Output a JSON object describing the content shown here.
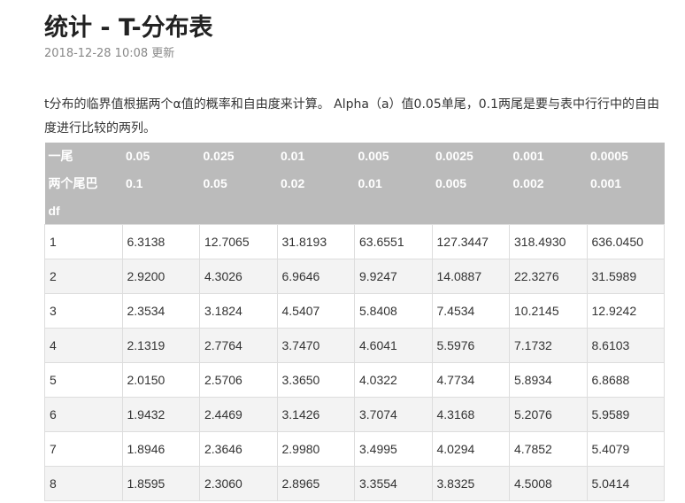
{
  "article": {
    "title": "统计 - T-分布表",
    "date": "2018-12-28 10:08",
    "updated_label": "更新",
    "intro": "t分布的临界值根据两个α值的概率和自由度来计算。 Alpha（a）值0.05单尾，0.1两尾是要与表中行行中的自由度进行比较的两列。"
  },
  "table": {
    "header_rows": [
      [
        "一尾",
        "0.05",
        "0.025",
        "0.01",
        "0.005",
        "0.0025",
        "0.001",
        "0.0005"
      ],
      [
        "两个尾巴",
        "0.1",
        "0.05",
        "0.02",
        "0.01",
        "0.005",
        "0.002",
        "0.001"
      ],
      [
        "df",
        "",
        "",
        "",
        "",
        "",
        "",
        ""
      ]
    ],
    "rows": [
      [
        "1",
        "6.3138",
        "12.7065",
        "31.8193",
        "63.6551",
        "127.3447",
        "318.4930",
        "636.0450"
      ],
      [
        "2",
        "2.9200",
        "4.3026",
        "6.9646",
        "9.9247",
        "14.0887",
        "22.3276",
        "31.5989"
      ],
      [
        "3",
        "2.3534",
        "3.1824",
        "4.5407",
        "5.8408",
        "7.4534",
        "10.2145",
        "12.9242"
      ],
      [
        "4",
        "2.1319",
        "2.7764",
        "3.7470",
        "4.6041",
        "5.5976",
        "7.1732",
        "8.6103"
      ],
      [
        "5",
        "2.0150",
        "2.5706",
        "3.3650",
        "4.0322",
        "4.7734",
        "5.8934",
        "6.8688"
      ],
      [
        "6",
        "1.9432",
        "2.4469",
        "3.1426",
        "3.7074",
        "4.3168",
        "5.2076",
        "5.9589"
      ],
      [
        "7",
        "1.8946",
        "2.3646",
        "2.9980",
        "3.4995",
        "4.0294",
        "4.7852",
        "5.4079"
      ],
      [
        "8",
        "1.8595",
        "2.3060",
        "2.8965",
        "3.3554",
        "3.8325",
        "4.5008",
        "5.0414"
      ]
    ]
  }
}
